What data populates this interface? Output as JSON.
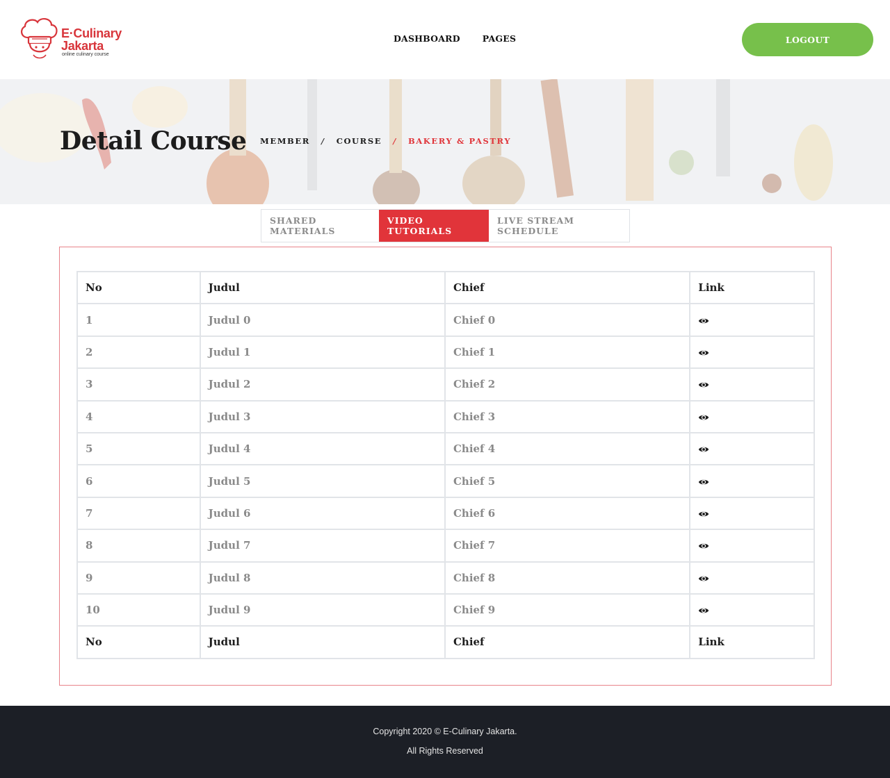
{
  "brand": {
    "name_line1": "E·Culinary",
    "name_line2": "Jakarta",
    "tagline": "online culinary course",
    "accent_color": "#d8353b"
  },
  "nav": {
    "items": [
      "DASHBOARD",
      "PAGES"
    ],
    "logout_label": "LOGOUT",
    "logout_color": "#77c04b"
  },
  "banner": {
    "title": "Detail Course",
    "breadcrumb": [
      "MEMBER",
      "COURSE",
      "BAKERY & PASTRY"
    ],
    "separator": "/"
  },
  "tabs": [
    {
      "label": "SHARED MATERIALS",
      "active": false
    },
    {
      "label": "VIDEO TUTORIALS",
      "active": true
    },
    {
      "label": "LIVE STREAM SCHEDULE",
      "active": false
    }
  ],
  "table": {
    "columns": [
      "No",
      "Judul",
      "Chief",
      "Link"
    ],
    "rows": [
      {
        "no": "1",
        "judul": "Judul 0",
        "chief": "Chief 0",
        "link_icon": "eye-icon"
      },
      {
        "no": "2",
        "judul": "Judul 1",
        "chief": "Chief 1",
        "link_icon": "eye-icon"
      },
      {
        "no": "3",
        "judul": "Judul 2",
        "chief": "Chief 2",
        "link_icon": "eye-icon"
      },
      {
        "no": "4",
        "judul": "Judul 3",
        "chief": "Chief 3",
        "link_icon": "eye-icon"
      },
      {
        "no": "5",
        "judul": "Judul 4",
        "chief": "Chief 4",
        "link_icon": "eye-icon"
      },
      {
        "no": "6",
        "judul": "Judul 5",
        "chief": "Chief 5",
        "link_icon": "eye-icon"
      },
      {
        "no": "7",
        "judul": "Judul 6",
        "chief": "Chief 6",
        "link_icon": "eye-icon"
      },
      {
        "no": "8",
        "judul": "Judul 7",
        "chief": "Chief 7",
        "link_icon": "eye-icon"
      },
      {
        "no": "9",
        "judul": "Judul 8",
        "chief": "Chief 8",
        "link_icon": "eye-icon"
      },
      {
        "no": "10",
        "judul": "Judul 9",
        "chief": "Chief 9",
        "link_icon": "eye-icon"
      }
    ]
  },
  "footer": {
    "line1": "Copyright 2020 © E-Culinary Jakarta.",
    "line2": "All Rights Reserved"
  }
}
